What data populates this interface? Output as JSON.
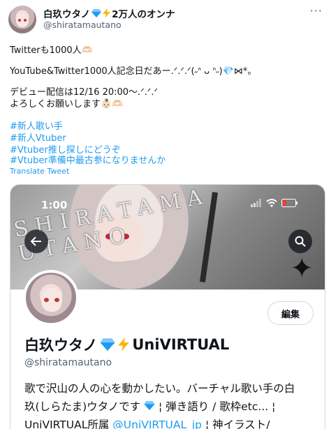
{
  "author": {
    "display_name": "白玖ウタノ",
    "name_suffix": "2万人のオンナ",
    "handle": "@shiratamautano"
  },
  "tweet": {
    "line1": "Twitterも1000人🫶🏻",
    "line2": "YouTube&Twitter1000人記念日だあー.ᐟ.ᐟ.ᐟ(˶ᐢ ᴗ ᐢ˶)💎⋈*。",
    "line3": "デビュー配信は12/16 20:00〜.ᐟ.ᐟ.ᐟ",
    "line4": "よろしくお願いします👶🏻🫶🏻",
    "hashtags": [
      "#新人歌い手",
      "#新人Vtuber",
      "#Vtuber推し探しにどうぞ",
      "#Vtuber準備中最古参になりませんか"
    ],
    "translate": "Translate Tweet"
  },
  "media": {
    "status_time": "1:00",
    "banner_text": "SHIRATAMA UTANO",
    "edit_button": "編集",
    "profile_name": "白玖ウタノ",
    "profile_name_suffix": "UniVIRTUAL",
    "profile_handle": "@shiratamautano",
    "bio_line1": "歌で沢山の人の心を動かしたい。バーチャル歌い手の白",
    "bio_line2a": "玖(しらたま)ウタノです",
    "bio_line2b": "¦ 弾き語り / 歌枠etc... ¦",
    "bio_line3a": "UniVIRTUAL所属 ",
    "bio_line3_link": "@UniVIRTUAL_jp",
    "bio_line3b": " ¦ 神イラスト/"
  },
  "colors": {
    "link": "#1d9bf0",
    "muted": "#536471",
    "gem": "#1d9bf0",
    "bolt": "#f7b500"
  },
  "icons": [
    "gem-icon",
    "lightning-icon",
    "more-icon",
    "back-arrow-icon",
    "search-icon",
    "signal-icon",
    "wifi-icon",
    "battery-icon",
    "star-icon"
  ]
}
